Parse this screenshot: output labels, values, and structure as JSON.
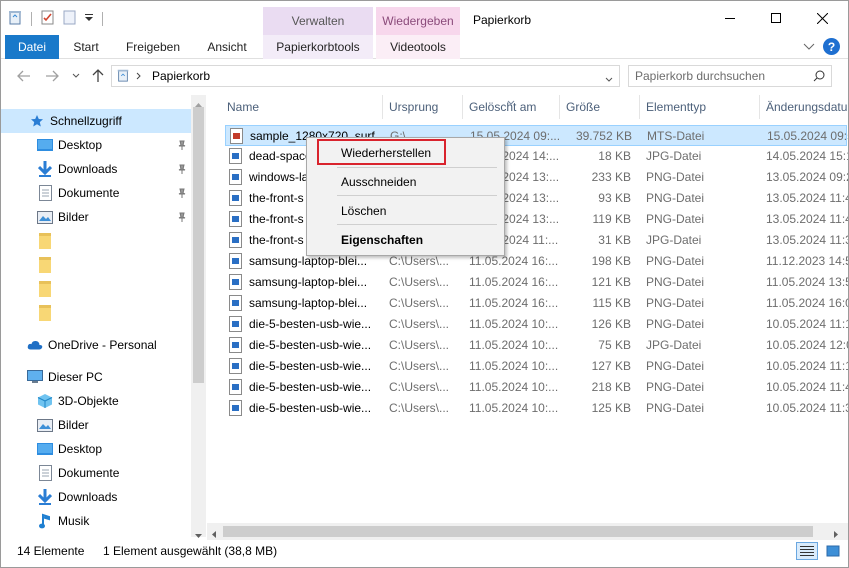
{
  "window": {
    "title": "Papierkorb",
    "context_tabs": [
      "Verwalten",
      "Wiedergeben"
    ]
  },
  "ribbon": {
    "tabs": [
      "Datei",
      "Start",
      "Freigeben",
      "Ansicht",
      "Papierkorbtools",
      "Videotools"
    ]
  },
  "address": {
    "path": "Papierkorb",
    "search_placeholder": "Papierkorb durchsuchen"
  },
  "nav": {
    "items": [
      {
        "label": "Schnellzugriff",
        "icon": "star-icon",
        "selected": true
      },
      {
        "label": "Desktop",
        "icon": "desktop-folder-icon",
        "pinned": true
      },
      {
        "label": "Downloads",
        "icon": "download-arrow-icon",
        "pinned": true
      },
      {
        "label": "Dokumente",
        "icon": "document-icon",
        "pinned": true
      },
      {
        "label": "Bilder",
        "icon": "pictures-icon",
        "pinned": true
      },
      {
        "label": "",
        "icon": "folder-icon"
      },
      {
        "label": "",
        "icon": "folder-icon"
      },
      {
        "label": "",
        "icon": "folder-icon"
      },
      {
        "label": "",
        "icon": "folder-icon"
      },
      {
        "label": "OneDrive - Personal",
        "icon": "cloud-icon"
      },
      {
        "label": "Dieser PC",
        "icon": "computer-icon"
      },
      {
        "label": "3D-Objekte",
        "icon": "cube-icon"
      },
      {
        "label": "Bilder",
        "icon": "pictures-icon"
      },
      {
        "label": "Desktop",
        "icon": "desktop-folder-icon"
      },
      {
        "label": "Dokumente",
        "icon": "document-icon"
      },
      {
        "label": "Downloads",
        "icon": "download-arrow-icon"
      },
      {
        "label": "Musik",
        "icon": "music-note-icon"
      }
    ]
  },
  "columns": [
    "Name",
    "Ursprung",
    "Gelöscht am",
    "Größe",
    "Elementtyp",
    "Änderungsdatu"
  ],
  "files": [
    {
      "name": "sample_1280x720_surf...",
      "origin": "G:\\",
      "deleted": "15.05.2024 09:...",
      "size": "39.752 KB",
      "type": "MTS-Datei",
      "modified": "15.05.2024 09:5",
      "selected": true
    },
    {
      "name": "dead-space",
      "origin": "",
      "deleted": "15.05.2024 14:...",
      "size": "18 KB",
      "type": "JPG-Datei",
      "modified": "14.05.2024 15:1"
    },
    {
      "name": "windows-la",
      "origin": "",
      "deleted": "13.05.2024 13:...",
      "size": "233 KB",
      "type": "PNG-Datei",
      "modified": "13.05.2024 09:2"
    },
    {
      "name": "the-front-s",
      "origin": "",
      "deleted": "13.05.2024 13:...",
      "size": "93 KB",
      "type": "PNG-Datei",
      "modified": "13.05.2024 11:4"
    },
    {
      "name": "the-front-s",
      "origin": "",
      "deleted": "13.05.2024 13:...",
      "size": "119 KB",
      "type": "PNG-Datei",
      "modified": "13.05.2024 11:4"
    },
    {
      "name": "the-front-s",
      "origin": "",
      "deleted": "13.05.2024 11:...",
      "size": "31 KB",
      "type": "JPG-Datei",
      "modified": "13.05.2024 11:3"
    },
    {
      "name": "samsung-laptop-blei...",
      "origin": "C:\\Users\\...",
      "deleted": "11.05.2024 16:...",
      "size": "198 KB",
      "type": "PNG-Datei",
      "modified": "11.12.2023 14:5"
    },
    {
      "name": "samsung-laptop-blei...",
      "origin": "C:\\Users\\...",
      "deleted": "11.05.2024 16:...",
      "size": "121 KB",
      "type": "PNG-Datei",
      "modified": "11.05.2024 13:5"
    },
    {
      "name": "samsung-laptop-blei...",
      "origin": "C:\\Users\\...",
      "deleted": "11.05.2024 16:...",
      "size": "115 KB",
      "type": "PNG-Datei",
      "modified": "11.05.2024 16:0"
    },
    {
      "name": "die-5-besten-usb-wie...",
      "origin": "C:\\Users\\...",
      "deleted": "11.05.2024 10:...",
      "size": "126 KB",
      "type": "PNG-Datei",
      "modified": "10.05.2024 11:1"
    },
    {
      "name": "die-5-besten-usb-wie...",
      "origin": "C:\\Users\\...",
      "deleted": "11.05.2024 10:...",
      "size": "75 KB",
      "type": "JPG-Datei",
      "modified": "10.05.2024 12:0"
    },
    {
      "name": "die-5-besten-usb-wie...",
      "origin": "C:\\Users\\...",
      "deleted": "11.05.2024 10:...",
      "size": "127 KB",
      "type": "PNG-Datei",
      "modified": "10.05.2024 11:1"
    },
    {
      "name": "die-5-besten-usb-wie...",
      "origin": "C:\\Users\\...",
      "deleted": "11.05.2024 10:...",
      "size": "218 KB",
      "type": "PNG-Datei",
      "modified": "10.05.2024 11:4"
    },
    {
      "name": "die-5-besten-usb-wie...",
      "origin": "C:\\Users\\...",
      "deleted": "11.05.2024 10:...",
      "size": "125 KB",
      "type": "PNG-Datei",
      "modified": "10.05.2024 11:3"
    }
  ],
  "context_menu": {
    "restore": "Wiederherstellen",
    "cut": "Ausschneiden",
    "delete": "Löschen",
    "properties": "Eigenschaften"
  },
  "status": {
    "count": "14 Elemente",
    "selection": "1 Element ausgewählt (38,8 MB)"
  },
  "colors": {
    "accent": "#1979ca",
    "selection": "#cce8ff",
    "highlight_border": "#d9232d"
  }
}
